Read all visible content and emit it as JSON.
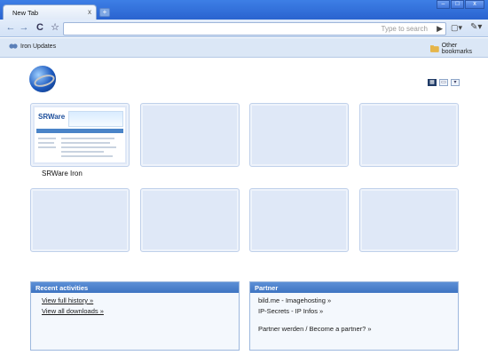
{
  "window": {
    "tab_title": "New Tab",
    "tab_close": "x",
    "new_tab": "+",
    "controls": [
      "–",
      "□",
      "x"
    ]
  },
  "toolbar": {
    "back": "←",
    "forward": "→",
    "reload": "C",
    "star": "☆",
    "omnibox_placeholder": "Type to search",
    "go": "▶",
    "page_menu": "▢▾",
    "wrench_menu": "✎▾"
  },
  "bookmarks": {
    "left_label": "Iron Updates",
    "right_label": "Other bookmarks"
  },
  "view_toggles": [
    "▦",
    "▭",
    "▾"
  ],
  "thumbnails": {
    "first_caption": "SRWare Iron",
    "mini_logo": "SRWare"
  },
  "recent": {
    "title": "Recent activities",
    "links": [
      "View full history »",
      "View all downloads »"
    ]
  },
  "partner": {
    "title": "Partner",
    "links": [
      "bild.me - Imagehosting »",
      "IP-Secrets - IP Infos »",
      "Partner werden / Become a partner? »"
    ]
  },
  "colors": {
    "titlebar": "#2a63cf",
    "panel_header": "#3e74c2",
    "thumb_fill": "#dfe8f7"
  }
}
